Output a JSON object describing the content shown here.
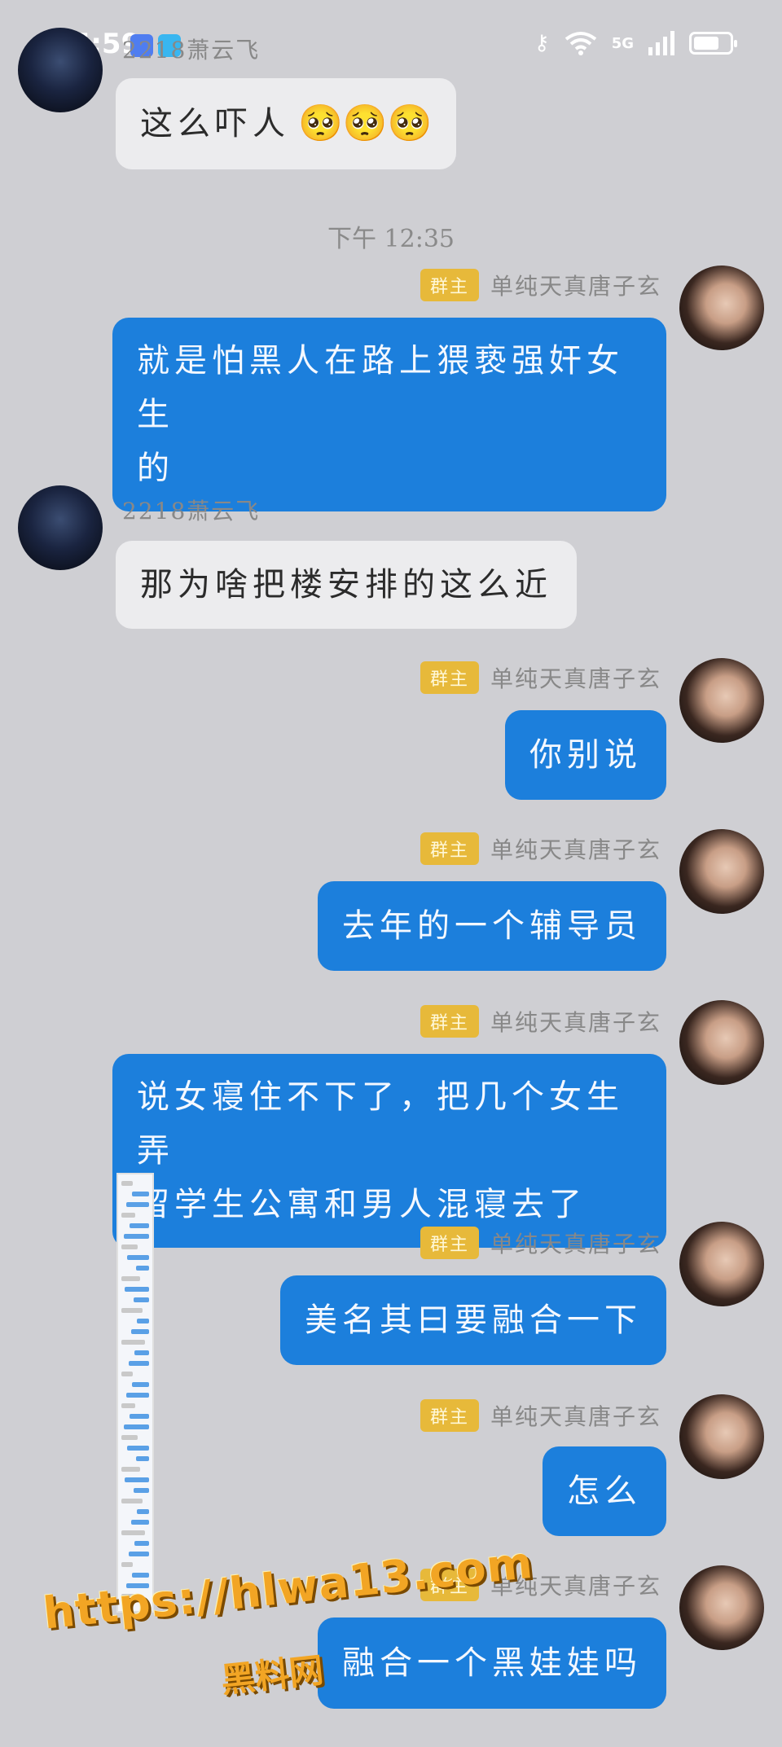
{
  "status_bar": {
    "time": "15:59",
    "signal_label": "5G",
    "icons": [
      "key-icon",
      "wifi-icon",
      "signal-icon",
      "battery-icon"
    ]
  },
  "messages": [
    {
      "side": "left",
      "sender": "2218萧云飞",
      "text": "这么吓人",
      "emoji": [
        "pleading-emoji",
        "pleading-emoji",
        "pleading-emoji"
      ]
    },
    {
      "type": "timestamp",
      "text": "下午 12:35"
    },
    {
      "side": "right",
      "badge": "群主",
      "sender": "单纯天真唐子玄",
      "lines": [
        "就是怕黑人在路上猥亵强奸女生",
        "的"
      ]
    },
    {
      "side": "left",
      "sender": "2218萧云飞",
      "text": "那为啥把楼安排的这么近"
    },
    {
      "side": "right",
      "badge": "群主",
      "sender": "单纯天真唐子玄",
      "text": "你别说"
    },
    {
      "side": "right",
      "badge": "群主",
      "sender": "单纯天真唐子玄",
      "text": "去年的一个辅导员"
    },
    {
      "side": "right",
      "badge": "群主",
      "sender": "单纯天真唐子玄",
      "lines": [
        "说女寝住不下了，把几个女生弄",
        "留学生公寓和男人混寝去了"
      ]
    },
    {
      "side": "right",
      "badge": "群主",
      "sender": "单纯天真唐子玄",
      "text": "美名其曰要融合一下"
    },
    {
      "side": "right",
      "badge": "群主",
      "sender": "单纯天真唐子玄",
      "text": "怎么"
    },
    {
      "side": "right",
      "badge": "群主",
      "sender": "单纯天真唐子玄",
      "text": "融合一个黑娃娃吗"
    }
  ],
  "watermark": {
    "url": "https://hlwa13.com",
    "brand": "黑料网"
  },
  "colors": {
    "background": "#cfcfd3",
    "bubble_right": "#1c7fdc",
    "bubble_left": "#ececee",
    "admin_badge": "#e7b93a",
    "watermark": "#f2a524"
  }
}
